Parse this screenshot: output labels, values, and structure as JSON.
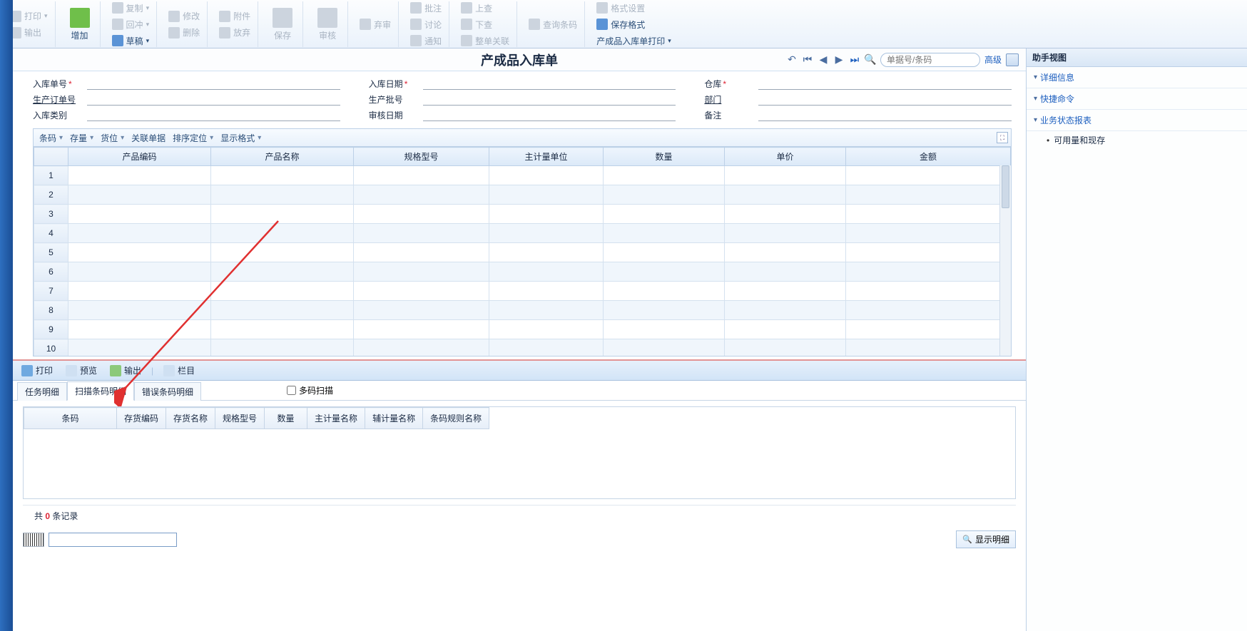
{
  "ribbon": {
    "print": "打印",
    "export": "输出",
    "add": "增加",
    "copy": "复制",
    "undo": "回冲",
    "draft": "草稿",
    "modify": "修改",
    "delete": "删除",
    "attach": "附件",
    "abandon": "放弃",
    "save": "保存",
    "approve": "审核",
    "reject": "弃审",
    "comment": "批注",
    "discuss": "讨论",
    "notify": "通知",
    "submit": "上查",
    "next": "下查",
    "relate": "整单关联",
    "barcode": "查询条码",
    "format": "格式设置",
    "saveformat": "保存格式",
    "printset": "产成品入库单打印"
  },
  "doc": {
    "title": "产成品入库单"
  },
  "search": {
    "placeholder": "单据号/条码",
    "advanced": "高级"
  },
  "form": {
    "f1": "入库单号",
    "f2": "入库日期",
    "f3": "仓库",
    "f4": "生产订单号",
    "f5": "生产批号",
    "f6": "部门",
    "f7": "入库类别",
    "f8": "审核日期",
    "f9": "备注"
  },
  "gridtb": {
    "barcode": "条码",
    "stock": "存量",
    "loc": "货位",
    "rel": "关联单据",
    "sort": "排序定位",
    "disp": "显示格式"
  },
  "cols": {
    "c1": "产品编码",
    "c2": "产品名称",
    "c3": "规格型号",
    "c4": "主计量单位",
    "c5": "数量",
    "c6": "单价",
    "c7": "金额"
  },
  "rows": [
    "1",
    "2",
    "3",
    "4",
    "5",
    "6",
    "7",
    "8",
    "9",
    "10"
  ],
  "lowertb": {
    "print": "打印",
    "preview": "预览",
    "export": "输出",
    "columns": "栏目"
  },
  "tabs": {
    "t1": "任务明细",
    "t2": "扫描条码明细",
    "t3": "错误条码明细",
    "multi": "多码扫描"
  },
  "subcols": {
    "s1": "条码",
    "s2": "存货编码",
    "s3": "存货名称",
    "s4": "规格型号",
    "s5": "数量",
    "s6": "主计量名称",
    "s7": "辅计量名称",
    "s8": "条码规则名称"
  },
  "rec": {
    "prefix": "共",
    "count": "0",
    "suffix": "条记录"
  },
  "showdetail": "显示明细",
  "assist": {
    "title": "助手视图",
    "a1": "详细信息",
    "a2": "快捷命令",
    "a3": "业务状态报表",
    "sub1": "可用量和现存"
  }
}
